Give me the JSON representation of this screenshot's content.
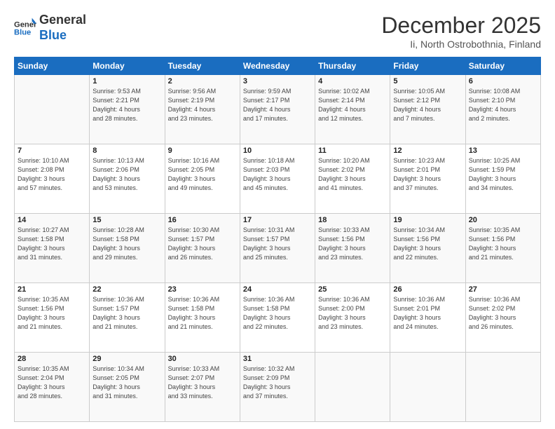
{
  "logo": {
    "line1": "General",
    "line2": "Blue"
  },
  "header": {
    "month": "December 2025",
    "location": "Ii, North Ostrobothnia, Finland"
  },
  "weekdays": [
    "Sunday",
    "Monday",
    "Tuesday",
    "Wednesday",
    "Thursday",
    "Friday",
    "Saturday"
  ],
  "weeks": [
    [
      {
        "day": "",
        "info": ""
      },
      {
        "day": "1",
        "info": "Sunrise: 9:53 AM\nSunset: 2:21 PM\nDaylight: 4 hours\nand 28 minutes."
      },
      {
        "day": "2",
        "info": "Sunrise: 9:56 AM\nSunset: 2:19 PM\nDaylight: 4 hours\nand 23 minutes."
      },
      {
        "day": "3",
        "info": "Sunrise: 9:59 AM\nSunset: 2:17 PM\nDaylight: 4 hours\nand 17 minutes."
      },
      {
        "day": "4",
        "info": "Sunrise: 10:02 AM\nSunset: 2:14 PM\nDaylight: 4 hours\nand 12 minutes."
      },
      {
        "day": "5",
        "info": "Sunrise: 10:05 AM\nSunset: 2:12 PM\nDaylight: 4 hours\nand 7 minutes."
      },
      {
        "day": "6",
        "info": "Sunrise: 10:08 AM\nSunset: 2:10 PM\nDaylight: 4 hours\nand 2 minutes."
      }
    ],
    [
      {
        "day": "7",
        "info": "Sunrise: 10:10 AM\nSunset: 2:08 PM\nDaylight: 3 hours\nand 57 minutes."
      },
      {
        "day": "8",
        "info": "Sunrise: 10:13 AM\nSunset: 2:06 PM\nDaylight: 3 hours\nand 53 minutes."
      },
      {
        "day": "9",
        "info": "Sunrise: 10:16 AM\nSunset: 2:05 PM\nDaylight: 3 hours\nand 49 minutes."
      },
      {
        "day": "10",
        "info": "Sunrise: 10:18 AM\nSunset: 2:03 PM\nDaylight: 3 hours\nand 45 minutes."
      },
      {
        "day": "11",
        "info": "Sunrise: 10:20 AM\nSunset: 2:02 PM\nDaylight: 3 hours\nand 41 minutes."
      },
      {
        "day": "12",
        "info": "Sunrise: 10:23 AM\nSunset: 2:01 PM\nDaylight: 3 hours\nand 37 minutes."
      },
      {
        "day": "13",
        "info": "Sunrise: 10:25 AM\nSunset: 1:59 PM\nDaylight: 3 hours\nand 34 minutes."
      }
    ],
    [
      {
        "day": "14",
        "info": "Sunrise: 10:27 AM\nSunset: 1:58 PM\nDaylight: 3 hours\nand 31 minutes."
      },
      {
        "day": "15",
        "info": "Sunrise: 10:28 AM\nSunset: 1:58 PM\nDaylight: 3 hours\nand 29 minutes."
      },
      {
        "day": "16",
        "info": "Sunrise: 10:30 AM\nSunset: 1:57 PM\nDaylight: 3 hours\nand 26 minutes."
      },
      {
        "day": "17",
        "info": "Sunrise: 10:31 AM\nSunset: 1:57 PM\nDaylight: 3 hours\nand 25 minutes."
      },
      {
        "day": "18",
        "info": "Sunrise: 10:33 AM\nSunset: 1:56 PM\nDaylight: 3 hours\nand 23 minutes."
      },
      {
        "day": "19",
        "info": "Sunrise: 10:34 AM\nSunset: 1:56 PM\nDaylight: 3 hours\nand 22 minutes."
      },
      {
        "day": "20",
        "info": "Sunrise: 10:35 AM\nSunset: 1:56 PM\nDaylight: 3 hours\nand 21 minutes."
      }
    ],
    [
      {
        "day": "21",
        "info": "Sunrise: 10:35 AM\nSunset: 1:56 PM\nDaylight: 3 hours\nand 21 minutes."
      },
      {
        "day": "22",
        "info": "Sunrise: 10:36 AM\nSunset: 1:57 PM\nDaylight: 3 hours\nand 21 minutes."
      },
      {
        "day": "23",
        "info": "Sunrise: 10:36 AM\nSunset: 1:58 PM\nDaylight: 3 hours\nand 21 minutes."
      },
      {
        "day": "24",
        "info": "Sunrise: 10:36 AM\nSunset: 1:58 PM\nDaylight: 3 hours\nand 22 minutes."
      },
      {
        "day": "25",
        "info": "Sunrise: 10:36 AM\nSunset: 2:00 PM\nDaylight: 3 hours\nand 23 minutes."
      },
      {
        "day": "26",
        "info": "Sunrise: 10:36 AM\nSunset: 2:01 PM\nDaylight: 3 hours\nand 24 minutes."
      },
      {
        "day": "27",
        "info": "Sunrise: 10:36 AM\nSunset: 2:02 PM\nDaylight: 3 hours\nand 26 minutes."
      }
    ],
    [
      {
        "day": "28",
        "info": "Sunrise: 10:35 AM\nSunset: 2:04 PM\nDaylight: 3 hours\nand 28 minutes."
      },
      {
        "day": "29",
        "info": "Sunrise: 10:34 AM\nSunset: 2:05 PM\nDaylight: 3 hours\nand 31 minutes."
      },
      {
        "day": "30",
        "info": "Sunrise: 10:33 AM\nSunset: 2:07 PM\nDaylight: 3 hours\nand 33 minutes."
      },
      {
        "day": "31",
        "info": "Sunrise: 10:32 AM\nSunset: 2:09 PM\nDaylight: 3 hours\nand 37 minutes."
      },
      {
        "day": "",
        "info": ""
      },
      {
        "day": "",
        "info": ""
      },
      {
        "day": "",
        "info": ""
      }
    ]
  ]
}
